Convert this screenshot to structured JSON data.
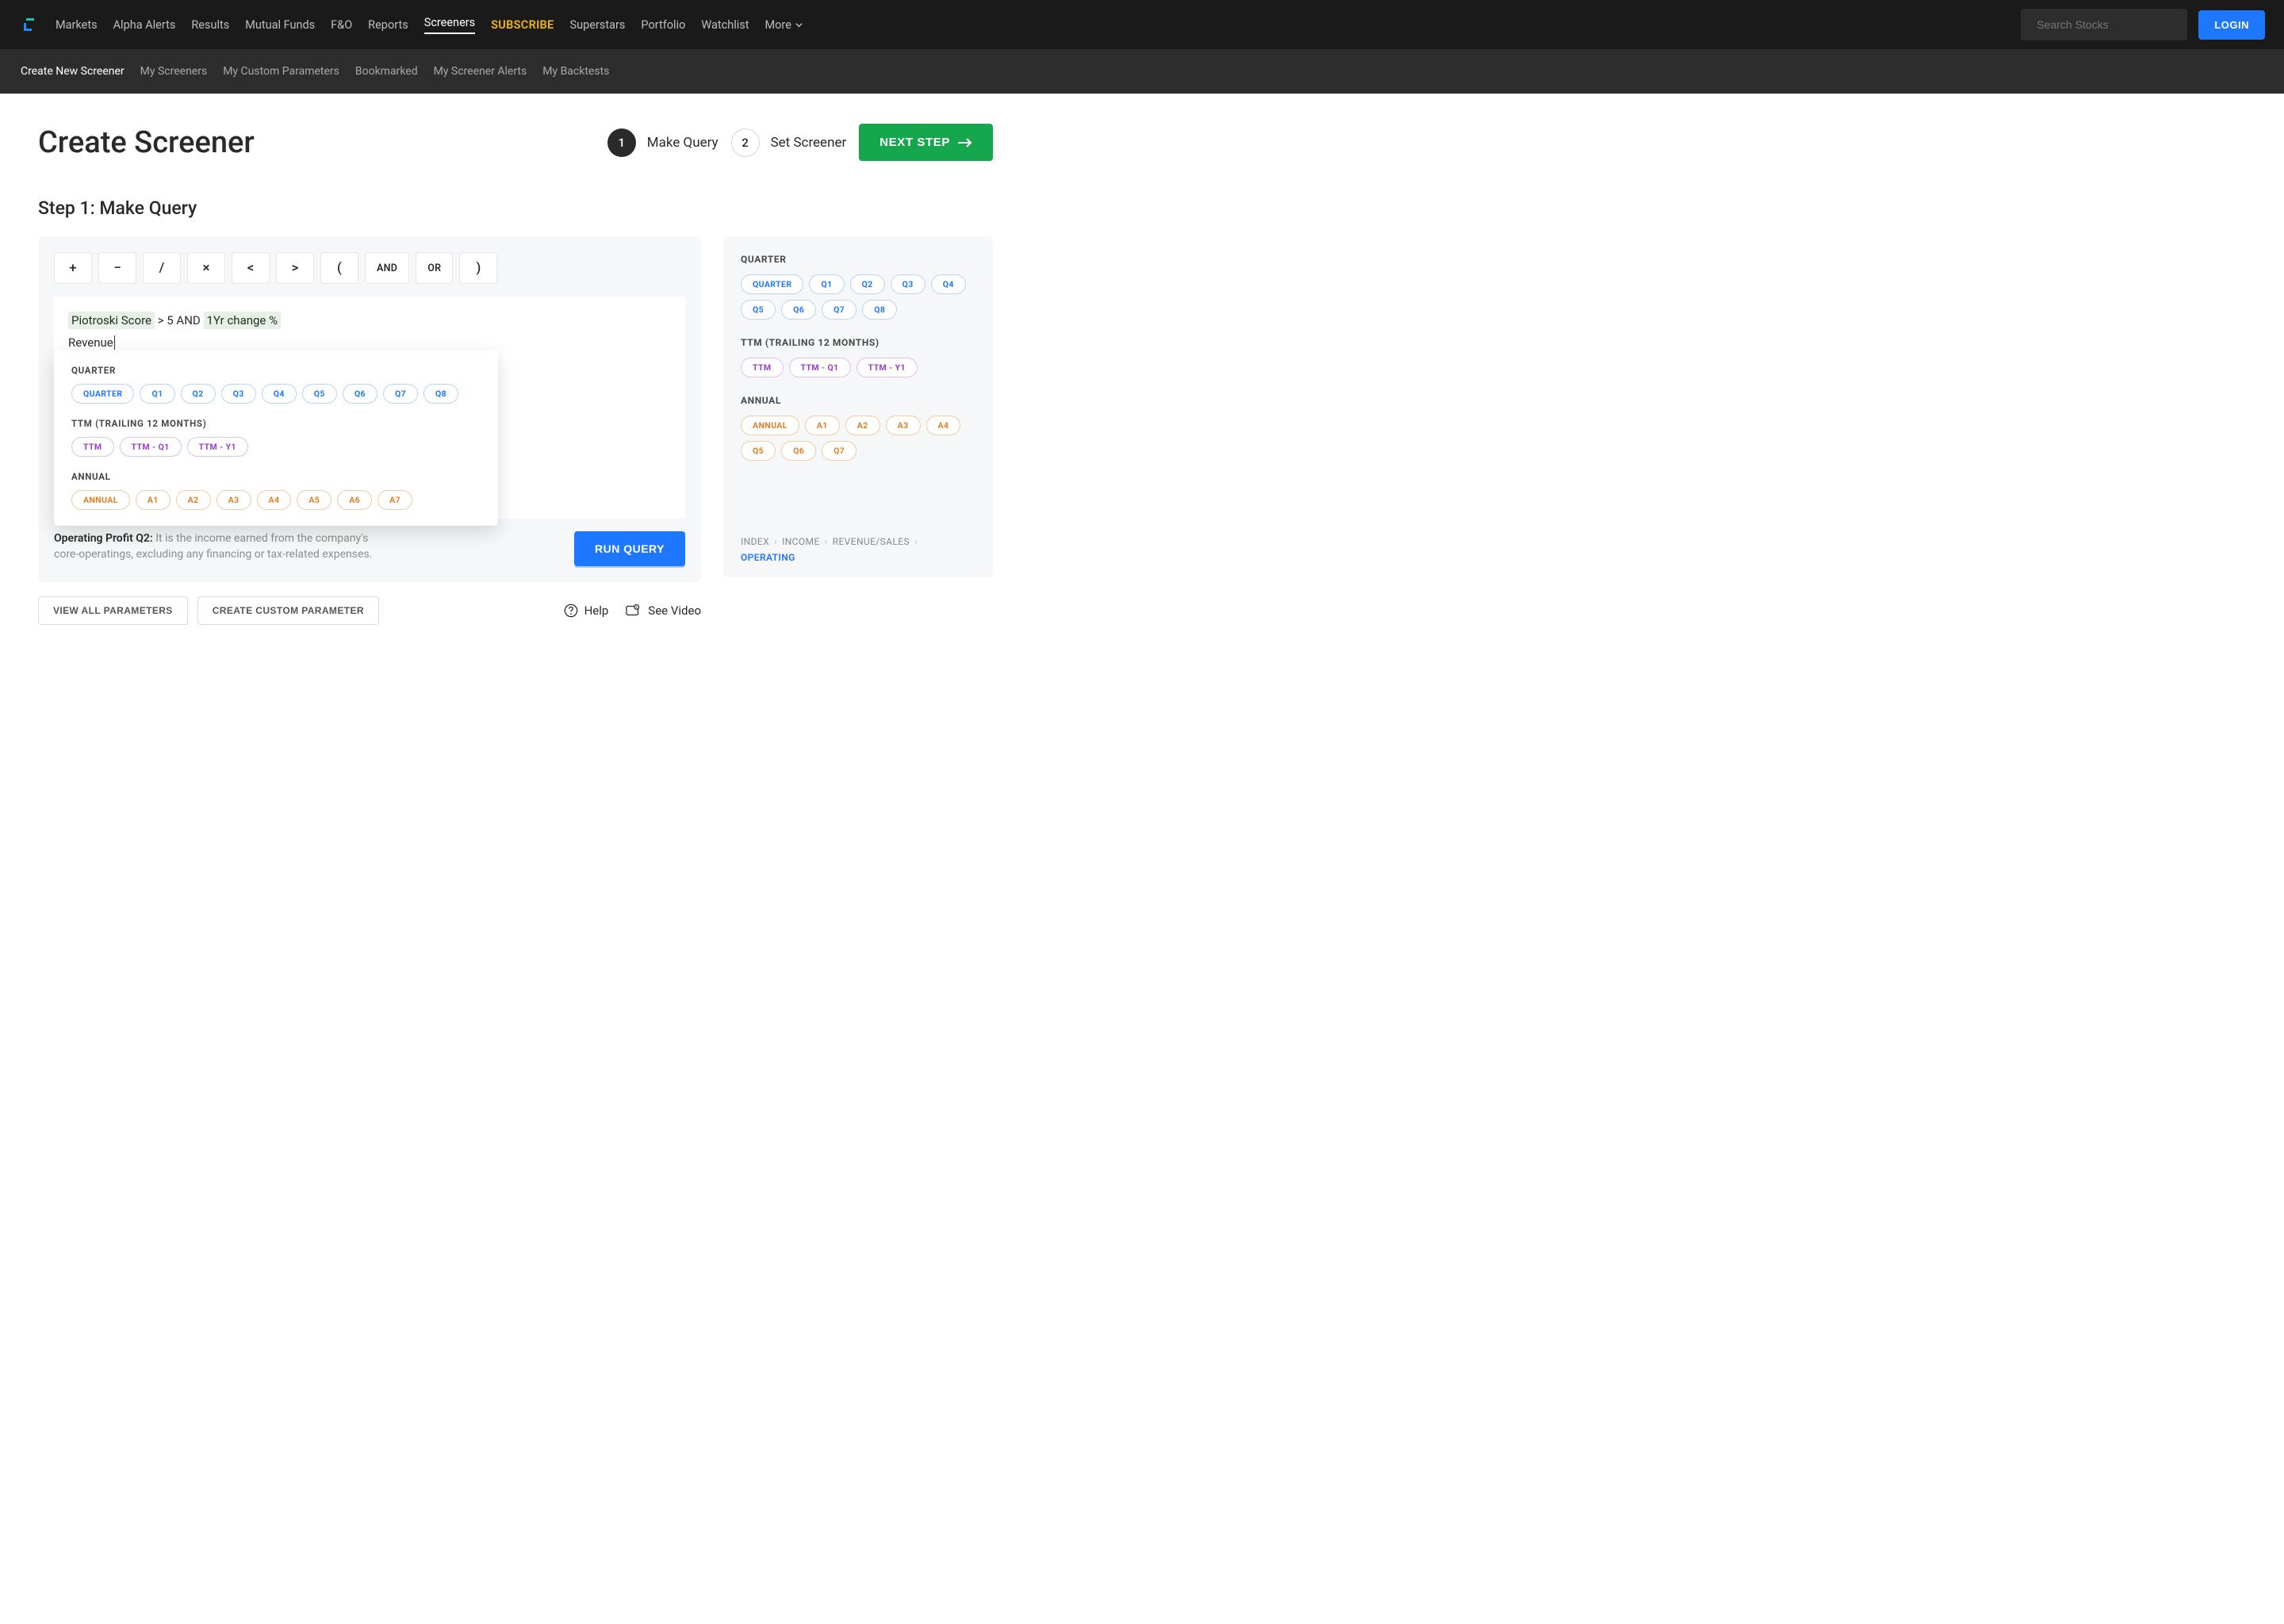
{
  "nav": {
    "items": [
      "Markets",
      "Alpha Alerts",
      "Results",
      "Mutual Funds",
      "F&O",
      "Reports",
      "Screeners",
      "SUBSCRIBE",
      "Superstars",
      "Portfolio",
      "Watchlist",
      "More"
    ],
    "search_placeholder": "Search Stocks",
    "login": "LOGIN"
  },
  "subnav": {
    "items": [
      "Create New Screener",
      "My Screeners",
      "My Custom Parameters",
      "Bookmarked",
      "My Screener Alerts",
      "My Backtests"
    ]
  },
  "page": {
    "title": "Create Screener",
    "step1_label": "Make Query",
    "step2_label": "Set Screener",
    "next": "NEXT STEP",
    "step_heading": "Step 1: Make Query"
  },
  "operators": {
    "plus": "+",
    "minus": "−",
    "div": "/",
    "mult": "×",
    "lt": "<",
    "gt": ">",
    "lparen": "(",
    "and": "AND",
    "or": "OR",
    "rparen": ")"
  },
  "query": {
    "token_piotroski": "Piotroski Score",
    "token_mid": " > 5  AND ",
    "token_1yr": "1Yr change %",
    "typing": "Revenue"
  },
  "dropdown": {
    "quarter_title": "QUARTER",
    "quarter_items": [
      "QUARTER",
      "Q1",
      "Q2",
      "Q3",
      "Q4",
      "Q5",
      "Q6",
      "Q7",
      "Q8"
    ],
    "ttm_title": "TTM (TRAILING 12 MONTHS)",
    "ttm_items": [
      "TTM",
      "TTM - Q1",
      "TTM - Y1"
    ],
    "annual_title": "ANNUAL",
    "annual_items": [
      "ANNUAL",
      "A1",
      "A2",
      "A3",
      "A4",
      "A5",
      "A6",
      "A7"
    ]
  },
  "definition": {
    "term": "Operating Profit Q2:",
    "text": " It is the income earned from the company's core-operatings, excluding any financing or tax-related expenses."
  },
  "run_query": "RUN QUERY",
  "footer": {
    "view_all": "VIEW ALL PARAMETERS",
    "create_custom": "CREATE CUSTOM PARAMETER",
    "help": "Help",
    "see_video": "See Video"
  },
  "side": {
    "quarter_title": "QUARTER",
    "quarter_items": [
      "QUARTER",
      "Q1",
      "Q2",
      "Q3",
      "Q4",
      "Q5",
      "Q6",
      "Q7",
      "Q8"
    ],
    "ttm_title": "TTM (TRAILING 12 MONTHS)",
    "ttm_items": [
      "TTM",
      "TTM - Q1",
      "TTM - Y1"
    ],
    "annual_title": "ANNUAL",
    "annual_items": [
      "ANNUAL",
      "A1",
      "A2",
      "A3",
      "A4",
      "Q5",
      "Q6",
      "Q7"
    ],
    "breadcrumb": [
      "INDEX",
      "INCOME",
      "REVENUE/SALES",
      "OPERATING"
    ]
  }
}
